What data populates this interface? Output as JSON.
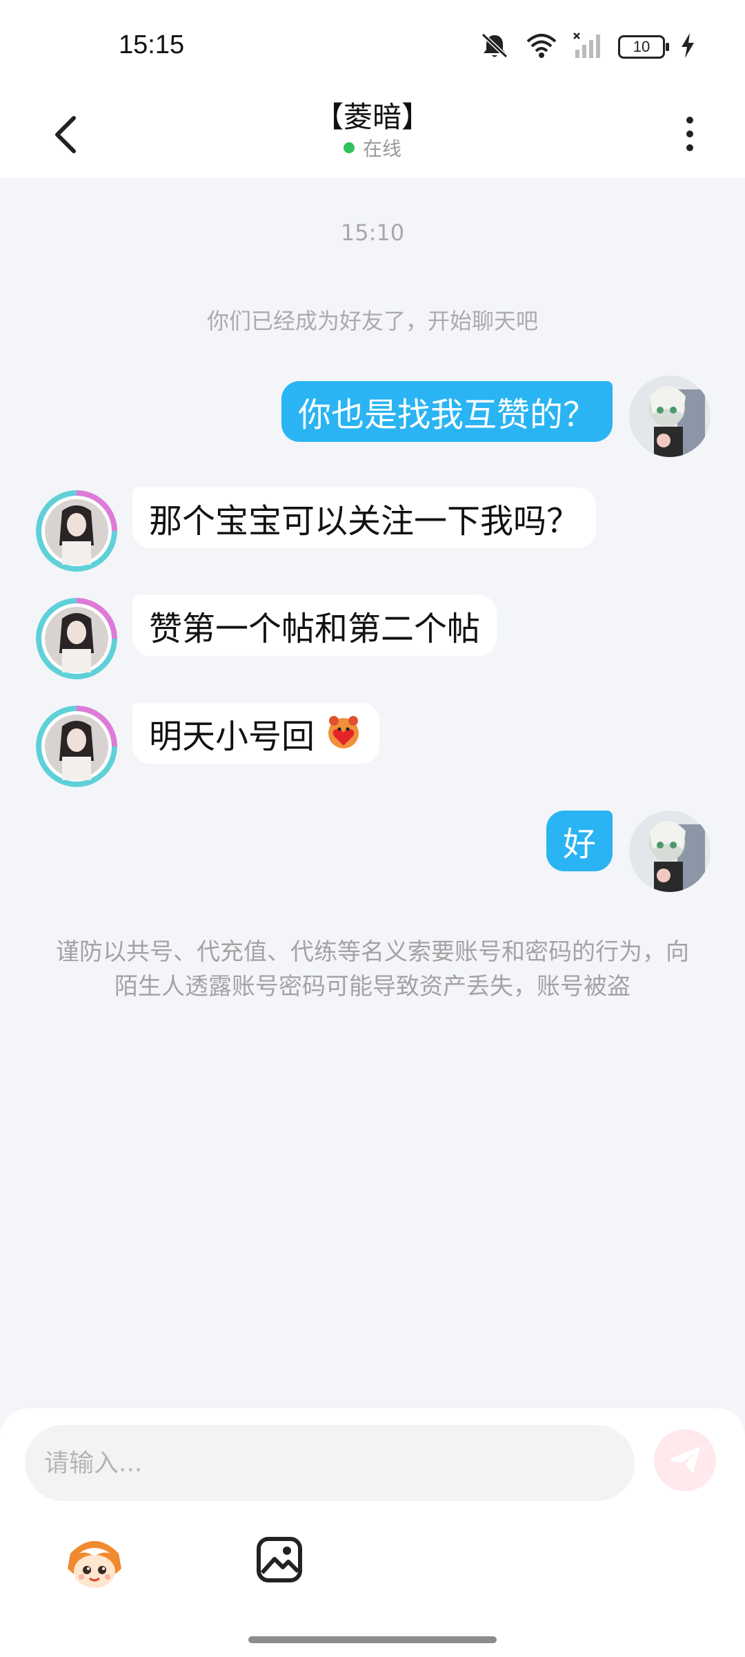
{
  "status_bar": {
    "time": "15:15",
    "battery": "10"
  },
  "header": {
    "title": "【菱暗】",
    "status": "在线"
  },
  "chat": {
    "timestamp": "15:10",
    "system_message": "你们已经成为好友了，开始聊天吧",
    "messages": [
      {
        "side": "right",
        "text": "你也是找我互赞的？"
      },
      {
        "side": "left",
        "text": "那个宝宝可以关注一下我吗？"
      },
      {
        "side": "left",
        "text": "赞第一个帖和第二个帖"
      },
      {
        "side": "left",
        "text": "明天小号回"
      },
      {
        "side": "right",
        "text": "好"
      }
    ],
    "warning": "谨防以共号、代充值、代练等名义索要账号和密码的行为，向陌生人透露账号密码可能导致资产丢失，账号被盗"
  },
  "input": {
    "placeholder": "请输入..."
  },
  "icons": {
    "back": "chevron-left-icon",
    "more": "more-vertical-icon",
    "send": "send-icon",
    "emoji": "emoji-mascot-icon",
    "image": "image-icon",
    "mute": "bell-mute-icon",
    "wifi": "wifi-icon",
    "signal": "signal-icon",
    "charging": "bolt-icon"
  },
  "colors": {
    "accent": "#2ab4f3",
    "background": "#f3f5f9",
    "online": "#2fc35b"
  }
}
